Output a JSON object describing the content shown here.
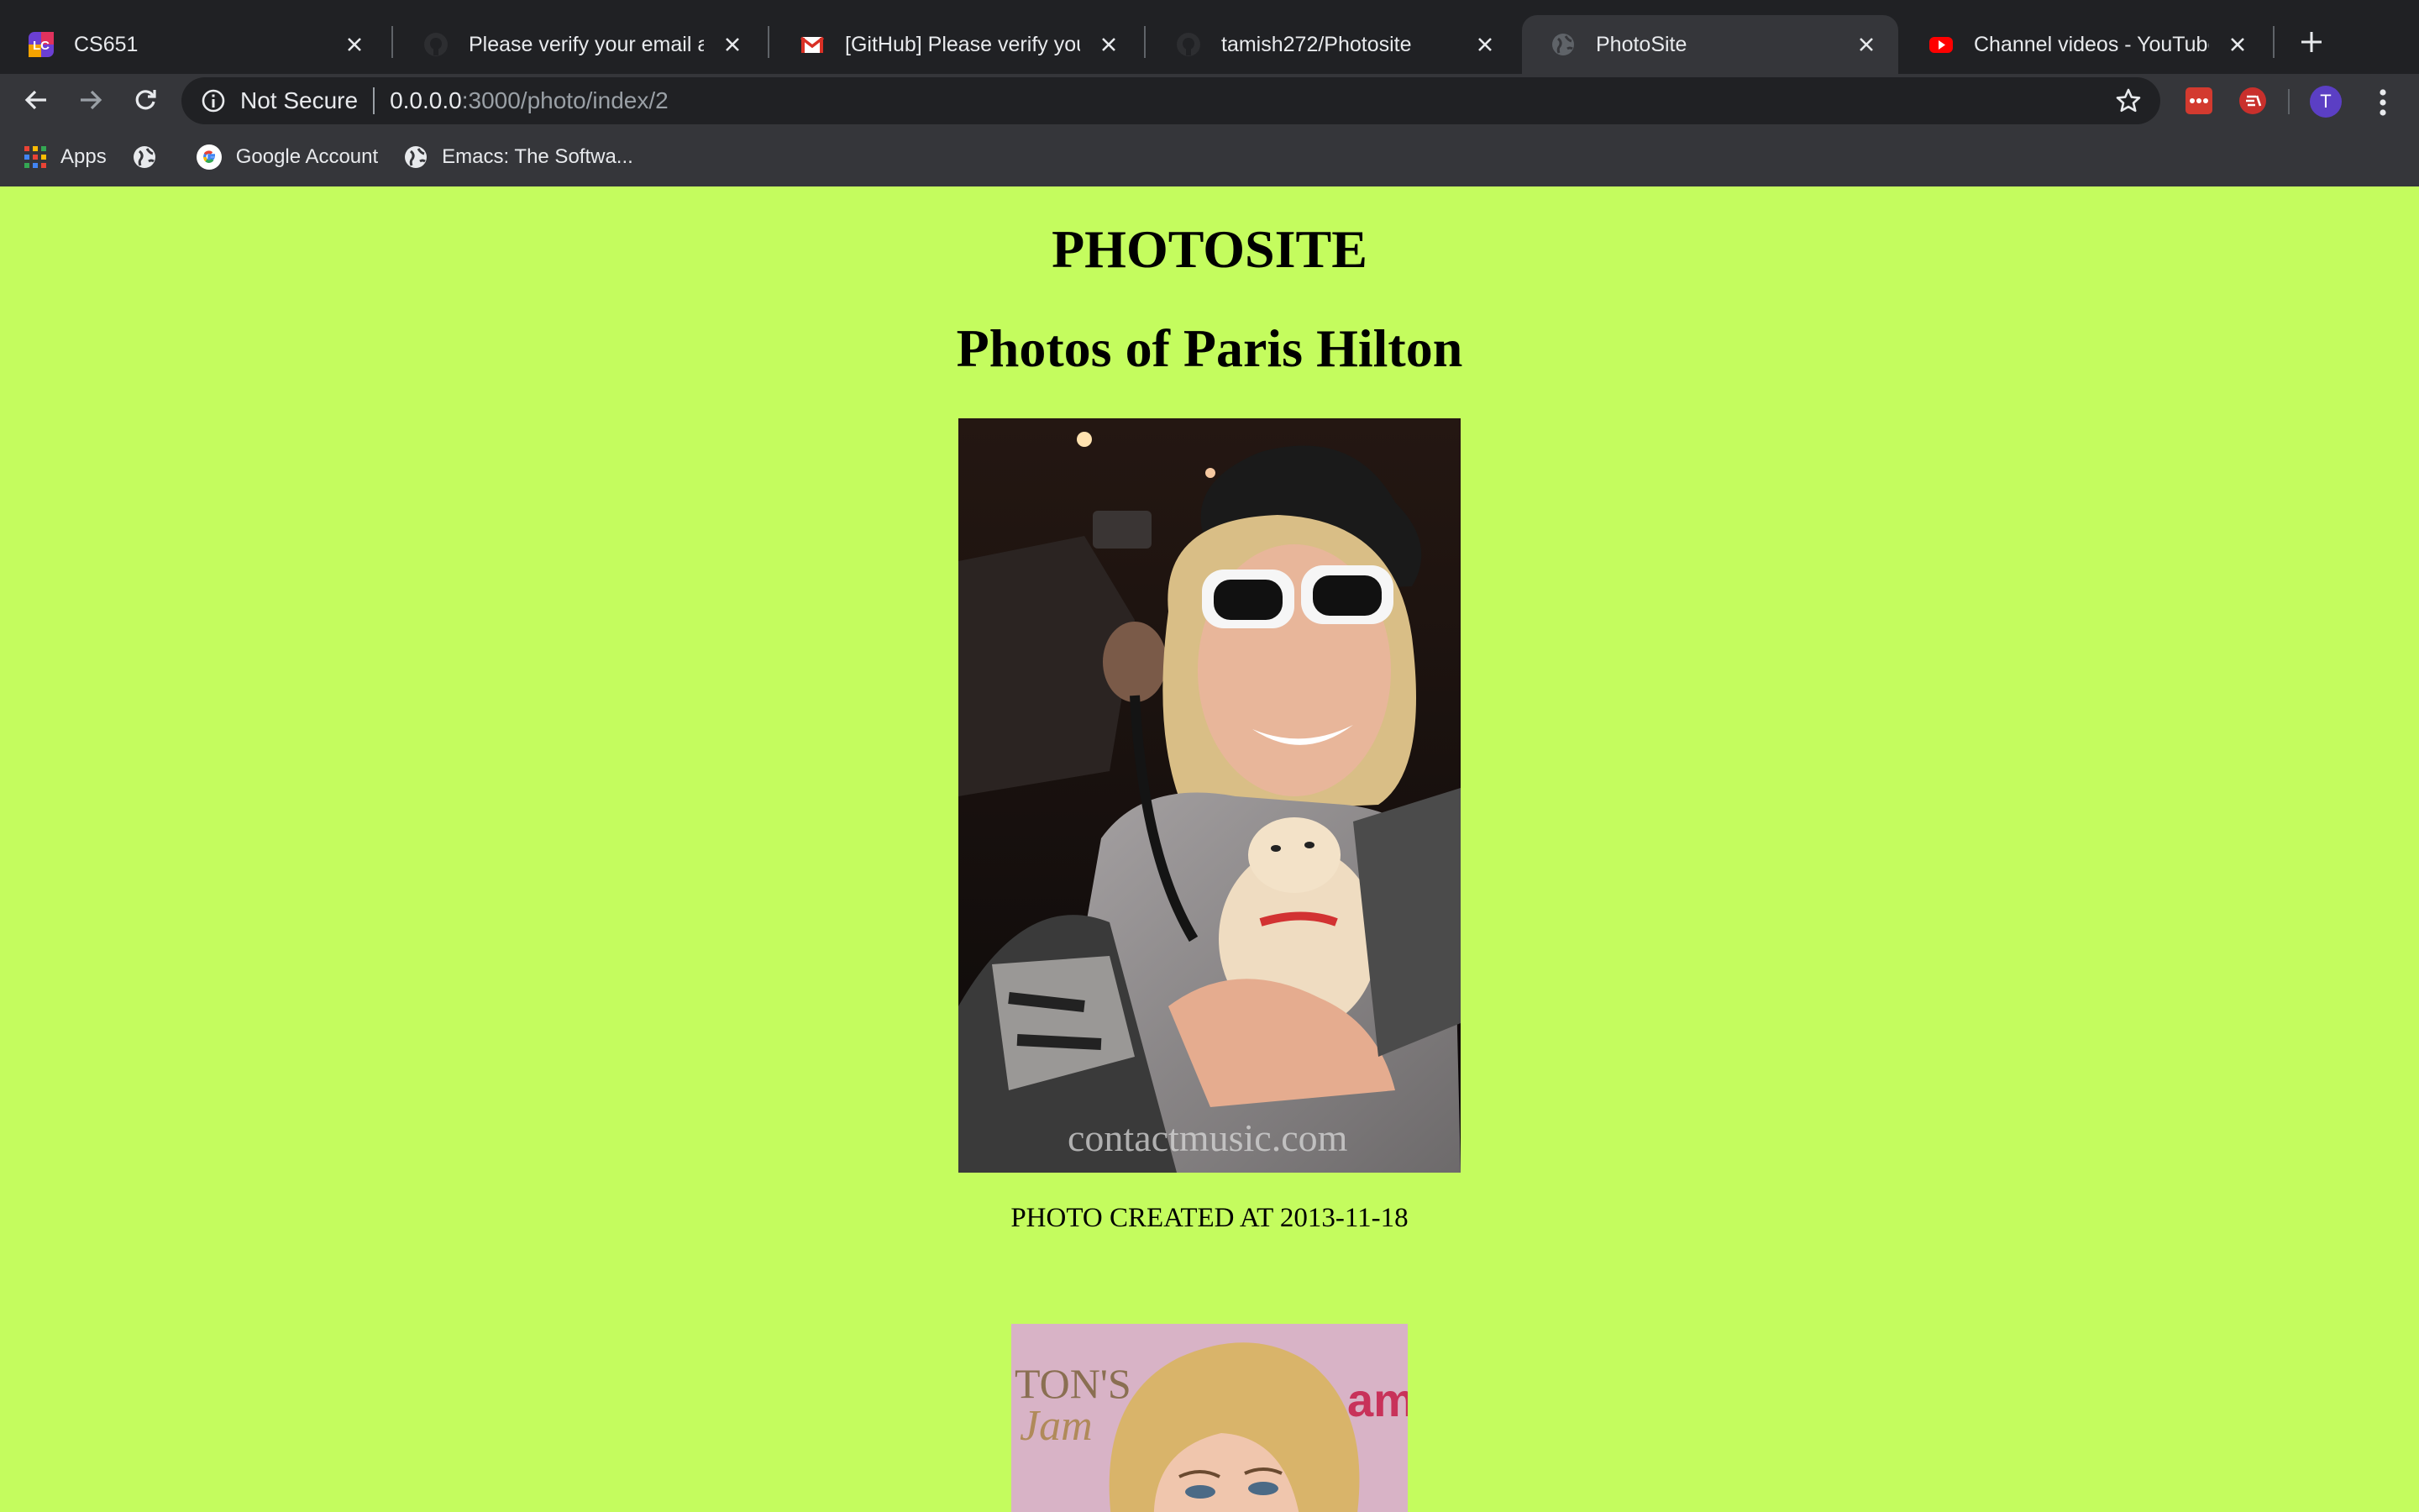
{
  "browser": {
    "tabs": [
      {
        "title": "CS651",
        "active": false
      },
      {
        "title": "Please verify your email addre",
        "active": false
      },
      {
        "title": "[GitHub] Please verify your em",
        "active": false
      },
      {
        "title": "tamish272/Photosite",
        "active": false
      },
      {
        "title": "PhotoSite",
        "active": true
      },
      {
        "title": "Channel videos - YouTube Stu",
        "active": false
      }
    ],
    "address": {
      "security_label": "Not Secure",
      "host": "0.0.0.0",
      "path": ":3000/photo/index/2"
    },
    "profile_initial": "T",
    "bookmarks": [
      {
        "label": "Apps",
        "icon": "apps-grid-icon"
      },
      {
        "label": "",
        "icon": "globe-icon"
      },
      {
        "label": "Google Account",
        "icon": "google-icon"
      },
      {
        "label": "Emacs: The Softwa...",
        "icon": "globe-icon"
      }
    ]
  },
  "page": {
    "site_title": "PHOTOSITE",
    "subtitle": "Photos of Paris Hilton",
    "photos": [
      {
        "caption": "PHOTO CREATED AT 2013-11-18",
        "watermark": "contactmusic.com"
      },
      {
        "caption": "",
        "watermark": ""
      }
    ],
    "background_color": "#c4fc5e"
  }
}
